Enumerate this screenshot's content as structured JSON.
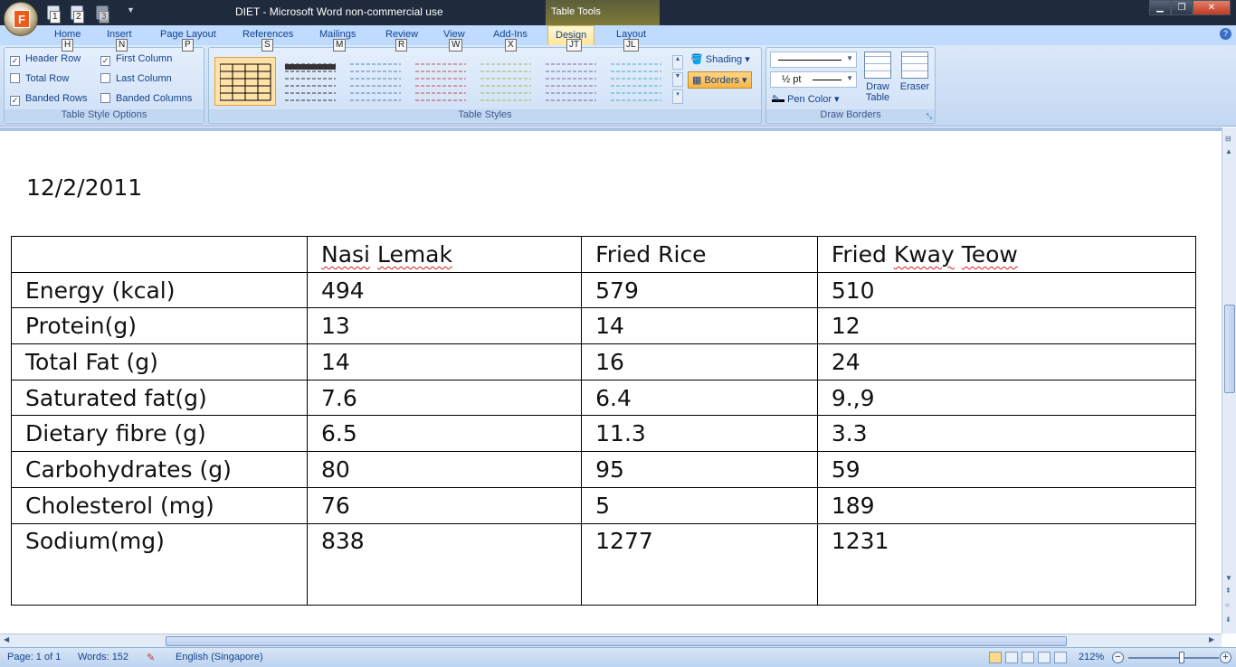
{
  "window": {
    "title": "DIET - Microsoft Word non-commercial use",
    "context_tab_label": "Table Tools",
    "office_button_letter": "F",
    "qat_keytips": [
      "1",
      "2",
      "3"
    ]
  },
  "ribbon": {
    "tabs": [
      {
        "label": "Home",
        "keytip": "H"
      },
      {
        "label": "Insert",
        "keytip": "N"
      },
      {
        "label": "Page Layout",
        "keytip": "P"
      },
      {
        "label": "References",
        "keytip": "S"
      },
      {
        "label": "Mailings",
        "keytip": "M"
      },
      {
        "label": "Review",
        "keytip": "R"
      },
      {
        "label": "View",
        "keytip": "W"
      },
      {
        "label": "Add-Ins",
        "keytip": "X"
      },
      {
        "label": "Design",
        "keytip": "JT"
      },
      {
        "label": "Layout",
        "keytip": "JL"
      }
    ],
    "table_style_options": {
      "label": "Table Style Options",
      "header_row": "Header Row",
      "total_row": "Total Row",
      "banded_rows": "Banded Rows",
      "first_column": "First Column",
      "last_column": "Last Column",
      "banded_columns": "Banded Columns"
    },
    "table_styles": {
      "label": "Table Styles",
      "shading": "Shading",
      "borders": "Borders",
      "swatch_colors": [
        "#000000",
        "#333333",
        "#4f81bd",
        "#c0504d",
        "#9bbb59",
        "#8064a2",
        "#4bacc6"
      ]
    },
    "draw_borders": {
      "label": "Draw Borders",
      "pen_weight": "½ pt",
      "pen_color": "Pen Color",
      "draw_table_line1": "Draw",
      "draw_table_line2": "Table",
      "eraser": "Eraser"
    }
  },
  "document": {
    "date": "12/2/2011",
    "table": {
      "header": [
        "",
        "Nasi Lemak",
        "Fried Rice",
        "Fried Kway Teow"
      ],
      "rows": [
        [
          "Energy (kcal)",
          "494",
          "579",
          "510"
        ],
        [
          "Protein(g)",
          "13",
          "14",
          "12"
        ],
        [
          "Total Fat (g)",
          "14",
          "16",
          "24"
        ],
        [
          "Saturated fat(g)",
          "7.6",
          "6.4",
          "9.,9"
        ],
        [
          "Dietary fibre (g)",
          "6.5",
          "11.3",
          "3.3"
        ],
        [
          "Carbohydrates (g)",
          "80",
          "95",
          "59"
        ],
        [
          "Cholesterol  (mg)",
          "76",
          "5",
          "189"
        ],
        [
          "Sodium(mg)",
          "838",
          "1277",
          "1231"
        ]
      ]
    }
  },
  "statusbar": {
    "page": "Page: 1 of 1",
    "words": "Words: 152",
    "language": "English (Singapore)",
    "zoom": "212%",
    "zoom_level_fraction": 0.59
  }
}
